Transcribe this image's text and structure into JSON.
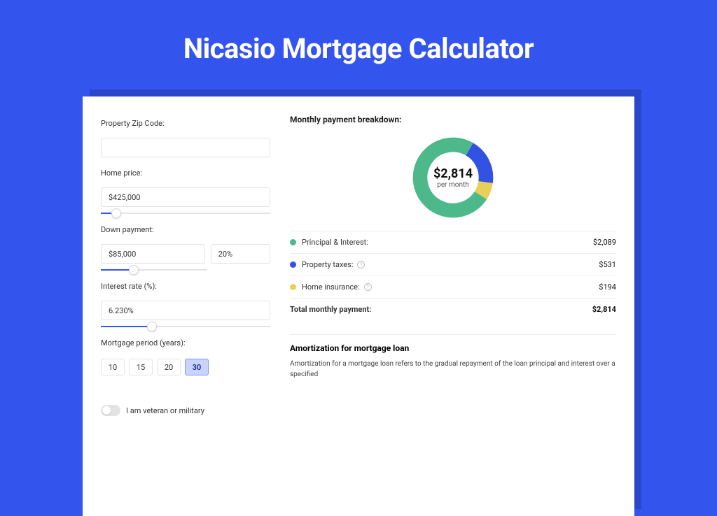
{
  "header": {
    "title": "Nicasio Mortgage Calculator"
  },
  "form": {
    "zip_label": "Property Zip Code:",
    "zip_value": "",
    "home_price_label": "Home price:",
    "home_price_value": "$425,000",
    "home_price_slider_pct": 9,
    "down_payment_label": "Down payment:",
    "down_payment_value": "$85,000",
    "down_payment_pct_value": "20%",
    "down_payment_slider_pct": 20,
    "interest_label": "Interest rate (%):",
    "interest_value": "6.230%",
    "interest_slider_pct": 30,
    "period_label": "Mortgage period (years):",
    "period_options": [
      "10",
      "15",
      "20",
      "30"
    ],
    "period_selected": "30",
    "veteran_label": "I am veteran or military"
  },
  "breakdown": {
    "title": "Monthly payment breakdown:",
    "center_amount": "$2,814",
    "center_sub": "per month",
    "rows": [
      {
        "label": "Principal & Interest:",
        "amount": "$2,089",
        "color": "green",
        "info": false
      },
      {
        "label": "Property taxes:",
        "amount": "$531",
        "color": "blue",
        "info": true
      },
      {
        "label": "Home insurance:",
        "amount": "$194",
        "color": "yellow",
        "info": true
      }
    ],
    "total_label": "Total monthly payment:",
    "total_amount": "$2,814"
  },
  "amortization": {
    "title": "Amortization for mortgage loan",
    "body": "Amortization for a mortgage loan refers to the gradual repayment of the loan principal and interest over a specified"
  },
  "chart_data": {
    "type": "pie",
    "title": "Monthly payment breakdown",
    "series": [
      {
        "name": "Principal & Interest",
        "value": 2089,
        "color": "#4db98a"
      },
      {
        "name": "Property taxes",
        "value": 531,
        "color": "#3152e3"
      },
      {
        "name": "Home insurance",
        "value": 194,
        "color": "#e8cf57"
      }
    ],
    "total": 2814,
    "center_label": "$2,814 per month"
  }
}
